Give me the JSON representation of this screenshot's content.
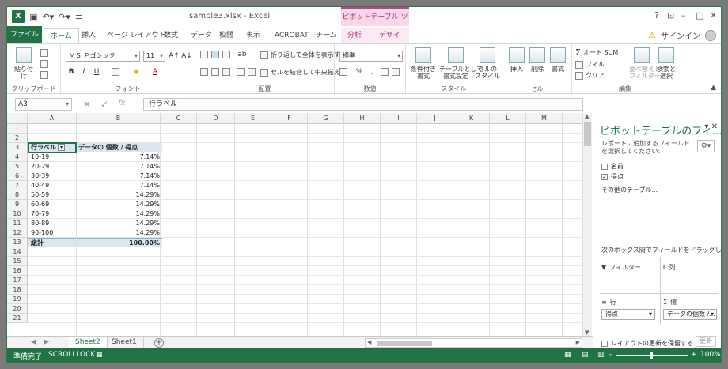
{
  "app": {
    "doc_title": "sample3.xlsx - Excel",
    "context_title": "ピボットテーブル ツール",
    "logo": "X"
  },
  "qat": {
    "save": "save-icon",
    "undo": "undo-icon",
    "redo": "redo-icon"
  },
  "window_controls": {
    "help": "?",
    "ribbon_display": "⊡",
    "minimize": "–",
    "restore": "□",
    "close": "✕"
  },
  "user": {
    "sign_in": "サインイン"
  },
  "tabs": [
    "ファイル",
    "ホーム",
    "挿入",
    "ページ レイアウト",
    "数式",
    "データ",
    "校閲",
    "表示",
    "ACROBAT",
    "チーム",
    "分析",
    "デザイン"
  ],
  "ribbon": {
    "clipboard": {
      "label": "クリップボード",
      "paste": "貼り付け"
    },
    "font": {
      "label": "フォント",
      "name": "ＭＳ Ｐゴシック",
      "size": "11",
      "bold": "B",
      "italic": "I",
      "underline": "U"
    },
    "alignment": {
      "label": "配置",
      "wrap": "折り返して全体を表示する",
      "merge": "セルを結合して中央揃え"
    },
    "number": {
      "label": "数値",
      "format": "標準",
      "percent": "%",
      "comma": ","
    },
    "styles": {
      "label": "スタイル",
      "conditional": "条件付き\n書式",
      "table": "テーブルとして\n書式設定",
      "cell": "セルの\nスタイル"
    },
    "cells": {
      "label": "セル",
      "insert": "挿入",
      "delete": "削除",
      "format": "書式"
    },
    "editing": {
      "label": "編集",
      "autosum": "オート SUM",
      "fill": "フィル",
      "clear": "クリア",
      "sort": "並べ替えと\nフィルター",
      "find": "検索と\n選択"
    }
  },
  "formula_bar": {
    "name_box": "A3",
    "formula": "行ラベル",
    "fx": "fx"
  },
  "columns": [
    "A",
    "B",
    "C",
    "D",
    "E",
    "F",
    "G",
    "H",
    "I",
    "J",
    "K",
    "L",
    "M"
  ],
  "rows": [
    "1",
    "2",
    "3",
    "4",
    "5",
    "6",
    "7",
    "8",
    "9",
    "10",
    "11",
    "12",
    "13",
    "14",
    "15",
    "16",
    "17",
    "18",
    "19",
    "20",
    "21"
  ],
  "pivot": {
    "header_label": "行ラベル",
    "header_value": "データの 個数 / 得点",
    "rows": [
      [
        "10-19",
        "7.14%"
      ],
      [
        "20-29",
        "7.14%"
      ],
      [
        "30-39",
        "7.14%"
      ],
      [
        "40-49",
        "7.14%"
      ],
      [
        "50-59",
        "14.29%"
      ],
      [
        "60-69",
        "14.29%"
      ],
      [
        "70-79",
        "14.29%"
      ],
      [
        "80-89",
        "14.29%"
      ],
      [
        "90-100",
        "14.29%"
      ]
    ],
    "total_label": "総計",
    "total_value": "100.00%"
  },
  "sheets": {
    "tabs": [
      "Sheet2",
      "Sheet1"
    ],
    "active": "Sheet2"
  },
  "pane": {
    "title": "ピボットテーブルのフィ...",
    "subtitle": "レポートに追加するフィールドを選択してください:",
    "fields": [
      {
        "name": "名前",
        "checked": false
      },
      {
        "name": "得点",
        "checked": true
      }
    ],
    "other_tables": "その他のテーブル...",
    "drag_hint": "次のボックス間でフィールドをドラッグしてください:",
    "filter_label": "フィルター",
    "columns_label": "列",
    "rows_label": "行",
    "values_label": "値",
    "rows_value": "得点",
    "values_value": "データの個数 /...",
    "defer": "レイアウトの更新を保留する",
    "update": "更新"
  },
  "status": {
    "ready": "準備完了",
    "scroll_lock": "SCROLLLOCK",
    "zoom": "100%"
  }
}
